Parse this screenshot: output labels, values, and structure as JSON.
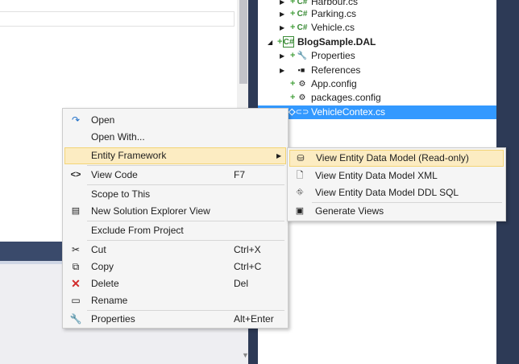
{
  "explorer": {
    "items": [
      {
        "label": "Harbour.cs",
        "indent": 2,
        "expander": true,
        "kind": "cs"
      },
      {
        "label": "Parking.cs",
        "indent": 2,
        "expander": true,
        "kind": "cs"
      },
      {
        "label": "Vehicle.cs",
        "indent": 2,
        "expander": true,
        "kind": "cs"
      },
      {
        "label": "BlogSample.DAL",
        "indent": 1,
        "expander": true,
        "kind": "project"
      },
      {
        "label": "Properties",
        "indent": 2,
        "expander": true,
        "kind": "wrench"
      },
      {
        "label": "References",
        "indent": 2,
        "expander": true,
        "kind": "refs"
      },
      {
        "label": "App.config",
        "indent": 2,
        "expander": false,
        "kind": "config"
      },
      {
        "label": "packages.config",
        "indent": 2,
        "expander": false,
        "kind": "config"
      },
      {
        "label": "VehicleContex.cs",
        "indent": 2,
        "expander": false,
        "kind": "cs-selected"
      }
    ]
  },
  "context_menu": {
    "items": [
      {
        "label": "Open",
        "shortcut": "",
        "icon": "open-icon"
      },
      {
        "label": "Open With...",
        "shortcut": "",
        "icon": ""
      },
      {
        "label": "Entity Framework",
        "shortcut": "",
        "icon": "",
        "submenu": true
      },
      {
        "label": "View Code",
        "shortcut": "F7",
        "icon": "view-code-icon"
      },
      {
        "label": "Scope to This",
        "shortcut": "",
        "icon": ""
      },
      {
        "label": "New Solution Explorer View",
        "shortcut": "",
        "icon": "new-explorer-view-icon"
      },
      {
        "label": "Exclude From Project",
        "shortcut": "",
        "icon": ""
      },
      {
        "label": "Cut",
        "shortcut": "Ctrl+X",
        "icon": "scissors-icon"
      },
      {
        "label": "Copy",
        "shortcut": "Ctrl+C",
        "icon": "copy-icon"
      },
      {
        "label": "Delete",
        "shortcut": "Del",
        "icon": "delete-icon"
      },
      {
        "label": "Rename",
        "shortcut": "",
        "icon": "rename-icon"
      },
      {
        "label": "Properties",
        "shortcut": "Alt+Enter",
        "icon": "wrench-icon"
      }
    ]
  },
  "submenu": {
    "items": [
      {
        "label": "View Entity Data Model (Read-only)",
        "icon": "entity-model-icon"
      },
      {
        "label": "View Entity Data Model XML",
        "icon": "xml-icon"
      },
      {
        "label": "View Entity Data Model DDL SQL",
        "icon": "ddl-sql-icon"
      },
      {
        "label": "Generate Views",
        "icon": "generate-views-icon"
      }
    ]
  },
  "colors": {
    "selection": "#3399ff",
    "menu_highlight": "#fcecc2",
    "ide_dark": "#2d3a56"
  }
}
